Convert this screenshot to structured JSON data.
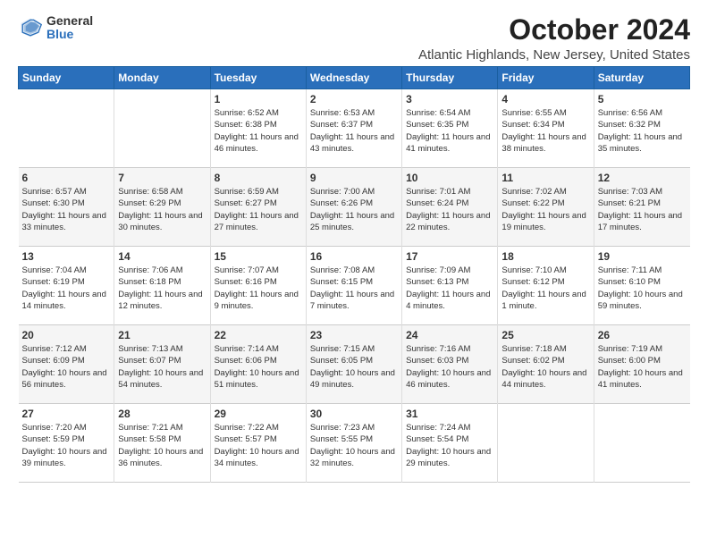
{
  "header": {
    "logo_general": "General",
    "logo_blue": "Blue",
    "month_title": "October 2024",
    "location": "Atlantic Highlands, New Jersey, United States"
  },
  "days_of_week": [
    "Sunday",
    "Monday",
    "Tuesday",
    "Wednesday",
    "Thursday",
    "Friday",
    "Saturday"
  ],
  "weeks": [
    [
      {
        "day": "",
        "info": ""
      },
      {
        "day": "",
        "info": ""
      },
      {
        "day": "1",
        "info": "Sunrise: 6:52 AM\nSunset: 6:38 PM\nDaylight: 11 hours and 46 minutes."
      },
      {
        "day": "2",
        "info": "Sunrise: 6:53 AM\nSunset: 6:37 PM\nDaylight: 11 hours and 43 minutes."
      },
      {
        "day": "3",
        "info": "Sunrise: 6:54 AM\nSunset: 6:35 PM\nDaylight: 11 hours and 41 minutes."
      },
      {
        "day": "4",
        "info": "Sunrise: 6:55 AM\nSunset: 6:34 PM\nDaylight: 11 hours and 38 minutes."
      },
      {
        "day": "5",
        "info": "Sunrise: 6:56 AM\nSunset: 6:32 PM\nDaylight: 11 hours and 35 minutes."
      }
    ],
    [
      {
        "day": "6",
        "info": "Sunrise: 6:57 AM\nSunset: 6:30 PM\nDaylight: 11 hours and 33 minutes."
      },
      {
        "day": "7",
        "info": "Sunrise: 6:58 AM\nSunset: 6:29 PM\nDaylight: 11 hours and 30 minutes."
      },
      {
        "day": "8",
        "info": "Sunrise: 6:59 AM\nSunset: 6:27 PM\nDaylight: 11 hours and 27 minutes."
      },
      {
        "day": "9",
        "info": "Sunrise: 7:00 AM\nSunset: 6:26 PM\nDaylight: 11 hours and 25 minutes."
      },
      {
        "day": "10",
        "info": "Sunrise: 7:01 AM\nSunset: 6:24 PM\nDaylight: 11 hours and 22 minutes."
      },
      {
        "day": "11",
        "info": "Sunrise: 7:02 AM\nSunset: 6:22 PM\nDaylight: 11 hours and 19 minutes."
      },
      {
        "day": "12",
        "info": "Sunrise: 7:03 AM\nSunset: 6:21 PM\nDaylight: 11 hours and 17 minutes."
      }
    ],
    [
      {
        "day": "13",
        "info": "Sunrise: 7:04 AM\nSunset: 6:19 PM\nDaylight: 11 hours and 14 minutes."
      },
      {
        "day": "14",
        "info": "Sunrise: 7:06 AM\nSunset: 6:18 PM\nDaylight: 11 hours and 12 minutes."
      },
      {
        "day": "15",
        "info": "Sunrise: 7:07 AM\nSunset: 6:16 PM\nDaylight: 11 hours and 9 minutes."
      },
      {
        "day": "16",
        "info": "Sunrise: 7:08 AM\nSunset: 6:15 PM\nDaylight: 11 hours and 7 minutes."
      },
      {
        "day": "17",
        "info": "Sunrise: 7:09 AM\nSunset: 6:13 PM\nDaylight: 11 hours and 4 minutes."
      },
      {
        "day": "18",
        "info": "Sunrise: 7:10 AM\nSunset: 6:12 PM\nDaylight: 11 hours and 1 minute."
      },
      {
        "day": "19",
        "info": "Sunrise: 7:11 AM\nSunset: 6:10 PM\nDaylight: 10 hours and 59 minutes."
      }
    ],
    [
      {
        "day": "20",
        "info": "Sunrise: 7:12 AM\nSunset: 6:09 PM\nDaylight: 10 hours and 56 minutes."
      },
      {
        "day": "21",
        "info": "Sunrise: 7:13 AM\nSunset: 6:07 PM\nDaylight: 10 hours and 54 minutes."
      },
      {
        "day": "22",
        "info": "Sunrise: 7:14 AM\nSunset: 6:06 PM\nDaylight: 10 hours and 51 minutes."
      },
      {
        "day": "23",
        "info": "Sunrise: 7:15 AM\nSunset: 6:05 PM\nDaylight: 10 hours and 49 minutes."
      },
      {
        "day": "24",
        "info": "Sunrise: 7:16 AM\nSunset: 6:03 PM\nDaylight: 10 hours and 46 minutes."
      },
      {
        "day": "25",
        "info": "Sunrise: 7:18 AM\nSunset: 6:02 PM\nDaylight: 10 hours and 44 minutes."
      },
      {
        "day": "26",
        "info": "Sunrise: 7:19 AM\nSunset: 6:00 PM\nDaylight: 10 hours and 41 minutes."
      }
    ],
    [
      {
        "day": "27",
        "info": "Sunrise: 7:20 AM\nSunset: 5:59 PM\nDaylight: 10 hours and 39 minutes."
      },
      {
        "day": "28",
        "info": "Sunrise: 7:21 AM\nSunset: 5:58 PM\nDaylight: 10 hours and 36 minutes."
      },
      {
        "day": "29",
        "info": "Sunrise: 7:22 AM\nSunset: 5:57 PM\nDaylight: 10 hours and 34 minutes."
      },
      {
        "day": "30",
        "info": "Sunrise: 7:23 AM\nSunset: 5:55 PM\nDaylight: 10 hours and 32 minutes."
      },
      {
        "day": "31",
        "info": "Sunrise: 7:24 AM\nSunset: 5:54 PM\nDaylight: 10 hours and 29 minutes."
      },
      {
        "day": "",
        "info": ""
      },
      {
        "day": "",
        "info": ""
      }
    ]
  ]
}
